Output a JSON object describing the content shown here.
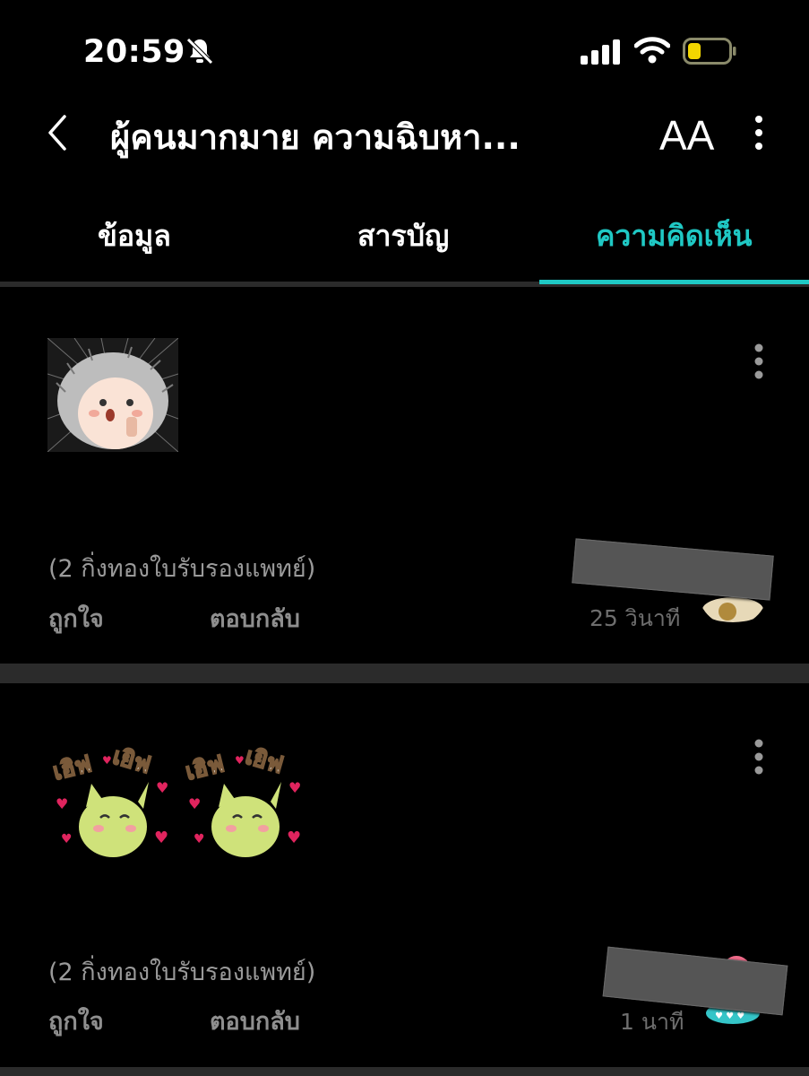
{
  "status_bar": {
    "time": "20:59",
    "bell_icon": "bell-slash-icon",
    "signal_icon": "cellular-signal-icon",
    "wifi_icon": "wifi-icon",
    "battery_icon": "battery-low-icon",
    "battery_color": "#f2d600"
  },
  "header": {
    "back_icon": "chevron-left-icon",
    "title": "ผู้คนมากมาย ความฉิบหา...",
    "font_button": "AA",
    "more_icon": "vertical-dots-icon"
  },
  "tabs": [
    {
      "label": "ข้อมูล",
      "active": false
    },
    {
      "label": "สารบัญ",
      "active": false
    },
    {
      "label": "ความคิดเห็น",
      "active": true
    }
  ],
  "accent_color": "#1fc8c4",
  "comments": [
    {
      "sticker": "hedgehog-sticker",
      "gift_text": "(2 กิ่งทองใบรับรองแพทย์)",
      "like_label": "ถูกใจ",
      "reply_label": "ตอบกลับ",
      "timestamp": "25 วินาที"
    },
    {
      "sticker": "yay-cats-sticker",
      "sticker_text": [
        "เฮิฟ",
        "เยิฟ",
        "เฮิฟ",
        "เยิฟ"
      ],
      "gift_text": "(2 กิ่งทองใบรับรองแพทย์)",
      "like_label": "ถูกใจ",
      "reply_label": "ตอบกลับ",
      "timestamp": "1 นาที"
    }
  ]
}
